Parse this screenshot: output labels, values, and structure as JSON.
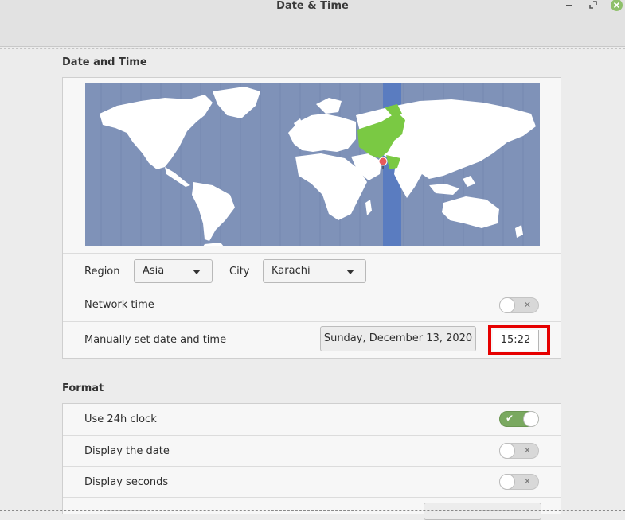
{
  "window": {
    "title": "Date & Time"
  },
  "date_time_section": {
    "heading": "Date and Time",
    "region_label": "Region",
    "region_value": "Asia",
    "city_label": "City",
    "city_value": "Karachi",
    "network_time_label": "Network time",
    "network_time_enabled": false,
    "manual_label": "Manually set date and time",
    "date_button": "Sunday, December 13, 2020",
    "time_value": "15:22"
  },
  "format_section": {
    "heading": "Format",
    "use_24h_label": "Use 24h clock",
    "use_24h_enabled": true,
    "display_date_label": "Display the date",
    "display_date_enabled": false,
    "display_seconds_label": "Display seconds",
    "display_seconds_enabled": false
  },
  "icons": {
    "minimize": "minimize-icon",
    "maximize": "maximize-icon",
    "close": "close-icon",
    "location_pin": "location-pin-icon",
    "check": "check-icon",
    "cross": "cross-icon"
  },
  "colors": {
    "map_ocean": "#7f92b8",
    "map_land": "#ffffff",
    "selected_timezone": "#5a7cc0",
    "selected_country": "#7ac943",
    "toggle_on": "#7aa960",
    "highlight": "#e60000"
  }
}
